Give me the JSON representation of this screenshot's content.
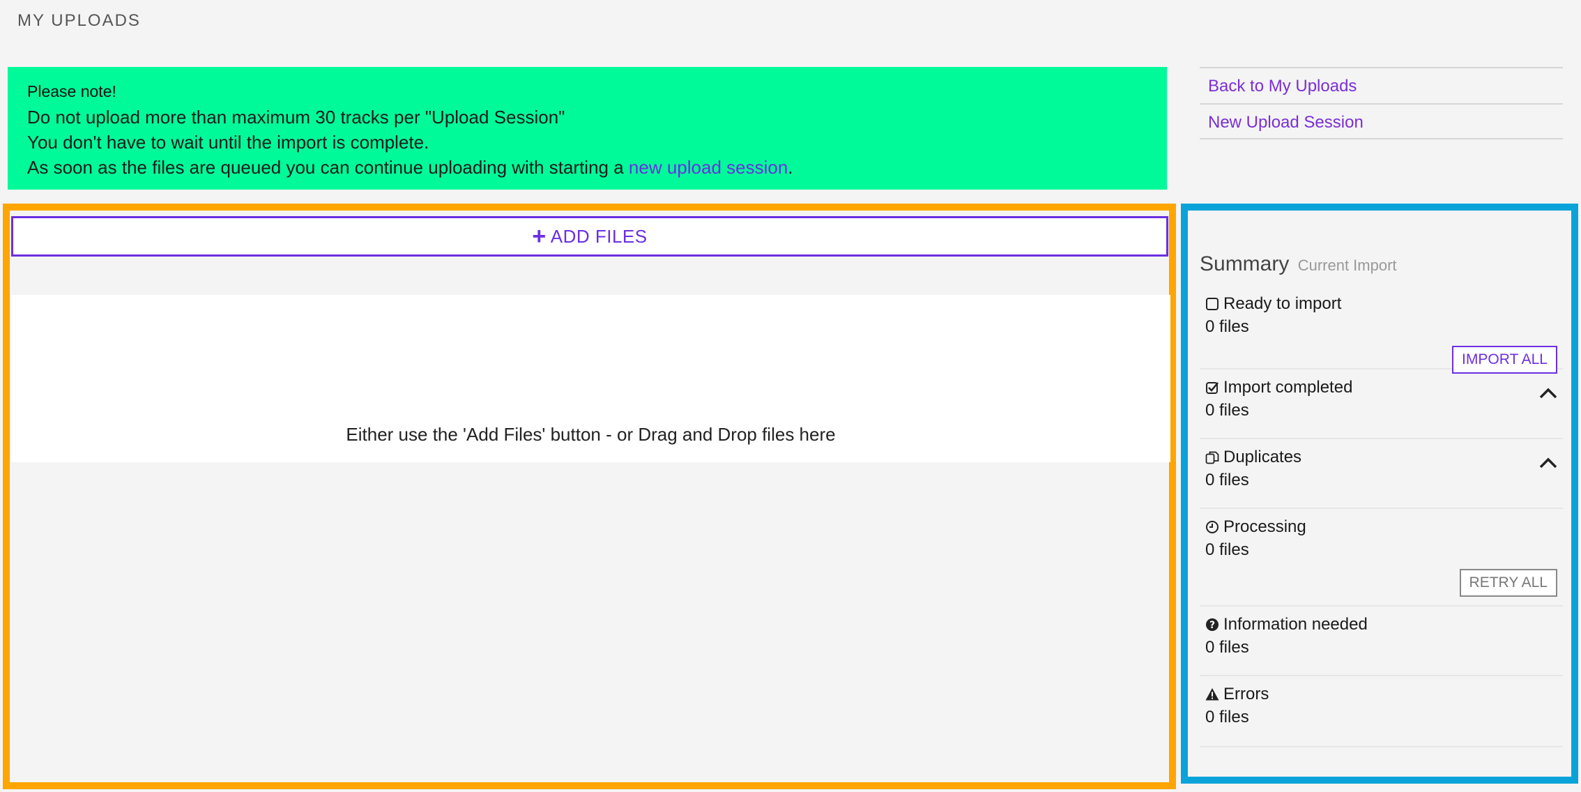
{
  "page": {
    "title": "MY UPLOADS"
  },
  "note": {
    "title": "Please note!",
    "line1": "Do not upload more than maximum 30 tracks per \"Upload Session\"",
    "line2": "You don't have to wait until the import is complete.",
    "line3_prefix": "As soon as the files are queued you can continue uploading with starting a ",
    "line3_link": "new upload session",
    "line3_suffix": "."
  },
  "side_links": {
    "back": "Back to My Uploads",
    "new_session": "New Upload Session"
  },
  "upload": {
    "add_files_label": "ADD FILES",
    "drop_hint": "Either use the 'Add Files' button - or Drag and Drop files here"
  },
  "summary": {
    "title": "Summary",
    "subtitle": "Current Import",
    "sections": [
      {
        "label": "Ready to import",
        "count": "0 files",
        "icon": "checkbox-empty-icon",
        "button": "IMPORT ALL"
      },
      {
        "label": "Import completed",
        "count": "0 files",
        "icon": "checkbox-checked-icon"
      },
      {
        "label": "Duplicates",
        "count": "0 files",
        "icon": "copy-icon"
      },
      {
        "label": "Processing",
        "count": "0 files",
        "icon": "clock-icon",
        "button": "RETRY ALL"
      },
      {
        "label": "Information needed",
        "count": "0 files",
        "icon": "question-circle-icon"
      },
      {
        "label": "Errors",
        "count": "0 files",
        "icon": "warning-icon"
      }
    ]
  },
  "colors": {
    "note_bg": "#00fa9a",
    "accent": "#6b2fe0",
    "upload_border": "#ffa500",
    "summary_border": "#0aa3d9"
  }
}
